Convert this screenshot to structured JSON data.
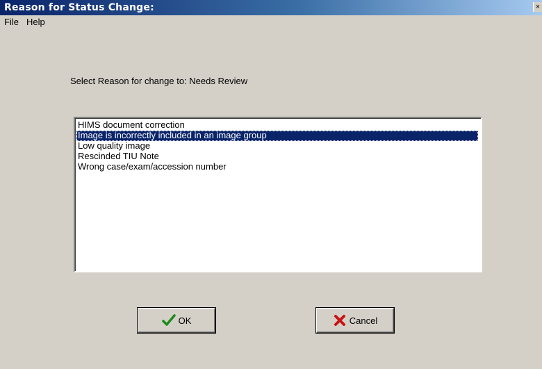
{
  "window": {
    "title": "Reason for Status Change:",
    "close_glyph": "×"
  },
  "menu": {
    "items": [
      "File",
      "Help"
    ]
  },
  "prompt": "Select Reason for change to: Needs Review",
  "list": {
    "items": [
      "HIMS document correction",
      "Image is incorrectly included in an image group",
      "Low quality image",
      "Rescinded TIU Note",
      "Wrong case/exam/accession number"
    ],
    "selected_index": 1
  },
  "buttons": {
    "ok": {
      "label": "OK",
      "icon": "checkmark-icon",
      "color": "#1c8a1c"
    },
    "cancel": {
      "label": "Cancel",
      "icon": "x-icon",
      "color": "#c81414"
    }
  }
}
